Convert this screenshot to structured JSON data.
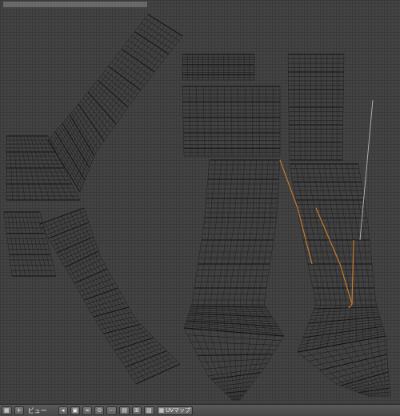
{
  "header": {
    "editor_icon": "uv-image-editor-icon",
    "view_menu": "ビュー",
    "uv_map_field": "UVマップ",
    "icons": [
      "arrow-icon",
      "image-icon",
      "link-icon",
      "pin-icon",
      "snap-icon",
      "grid-icon",
      "sticky-icon",
      "lock-icon"
    ]
  }
}
